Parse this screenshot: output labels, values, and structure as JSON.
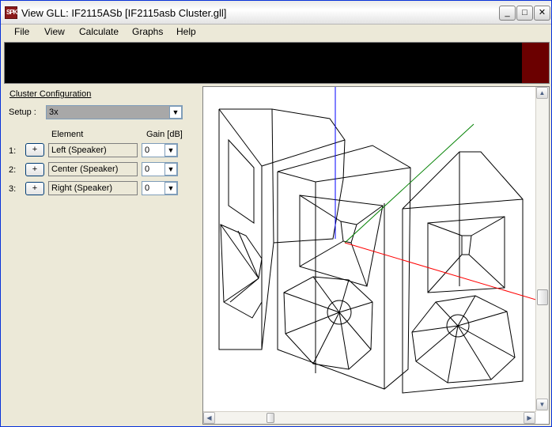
{
  "window": {
    "title": "View GLL: IF2115ASb [IF2115asb Cluster.gll]",
    "icon_label": "SPK",
    "min_glyph": "_",
    "max_glyph": "□",
    "close_glyph": "✕"
  },
  "menu": [
    "File",
    "View",
    "Calculate",
    "Graphs",
    "Help"
  ],
  "panel": {
    "section_title": "Cluster Configuration",
    "setup_label": "Setup :",
    "setup_value": "3x",
    "header_element": "Element",
    "header_gain": "Gain [dB]",
    "rows": [
      {
        "num": "1:",
        "plus": "+",
        "element": "Left (Speaker)",
        "gain": "0"
      },
      {
        "num": "2:",
        "plus": "+",
        "element": "Center (Speaker)",
        "gain": "0"
      },
      {
        "num": "3:",
        "plus": "+",
        "element": "Right (Speaker)",
        "gain": "0"
      }
    ]
  },
  "icons": {
    "dropdown": "▼",
    "arrow_up": "▲",
    "arrow_down": "▼",
    "arrow_left": "◀",
    "arrow_right": "▶"
  },
  "colors": {
    "axis_x": "#FF0000",
    "axis_y": "#008000",
    "axis_z": "#0000FF",
    "status_block": "#6B0000"
  }
}
